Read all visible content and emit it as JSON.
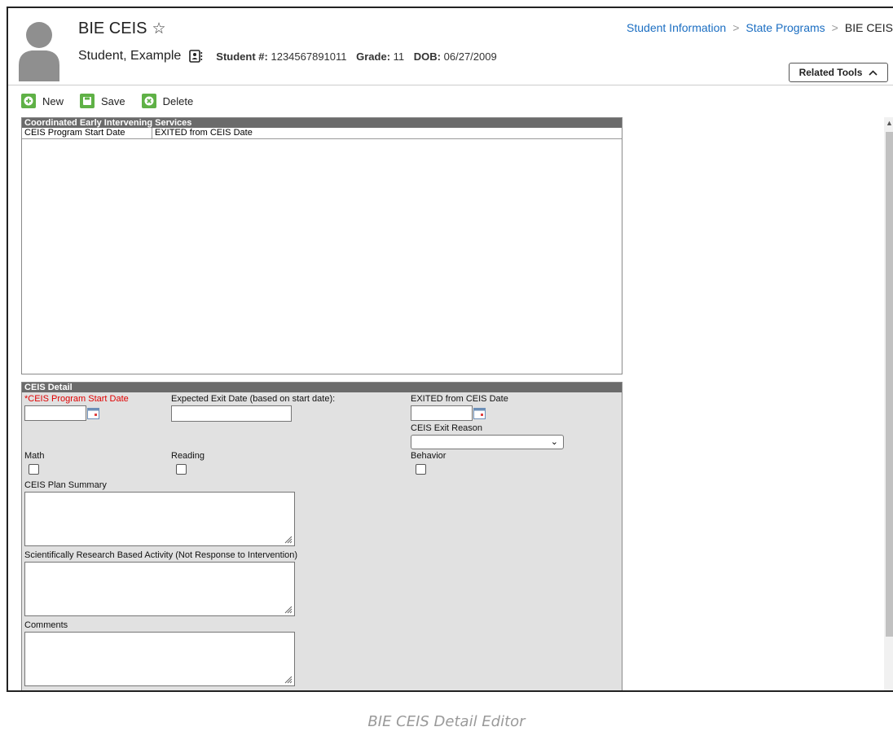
{
  "header": {
    "title": "BIE CEIS",
    "student_name": "Student, Example",
    "student_num_label": "Student #:",
    "student_num": "1234567891011",
    "grade_label": "Grade:",
    "grade": "11",
    "dob_label": "DOB:",
    "dob": "06/27/2009"
  },
  "breadcrumb": {
    "items": [
      "Student Information",
      "State Programs",
      "BIE CEIS"
    ]
  },
  "related_tools_label": "Related Tools",
  "toolbar": {
    "new_label": "New",
    "save_label": "Save",
    "delete_label": "Delete"
  },
  "list_panel": {
    "title": "Coordinated Early Intervening Services",
    "columns": [
      "CEIS Program Start Date",
      "EXITED from CEIS Date"
    ]
  },
  "detail": {
    "title": "CEIS Detail",
    "start_date_label": "*CEIS Program Start Date",
    "start_date_value": "",
    "expected_exit_label": "Expected Exit Date (based on start date):",
    "expected_exit_value": "",
    "exited_label": "EXITED from CEIS Date",
    "exited_value": "",
    "exit_reason_label": "CEIS Exit Reason",
    "exit_reason_value": "",
    "math_label": "Math",
    "reading_label": "Reading",
    "behavior_label": "Behavior",
    "math_checked": false,
    "reading_checked": false,
    "behavior_checked": false,
    "plan_summary_label": "CEIS Plan Summary",
    "plan_summary_value": "",
    "activity_label": "Scientifically Research Based Activity (Not Response to Intervention)",
    "activity_value": "",
    "comments_label": "Comments",
    "comments_value": ""
  },
  "caption": "BIE CEIS Detail Editor",
  "colors": {
    "link": "#1b6ec2",
    "panel_header": "#6b6b6b",
    "detail_bg": "#e1e1e1",
    "toolbar_icon": "#5fb146",
    "required": "#e00000"
  }
}
